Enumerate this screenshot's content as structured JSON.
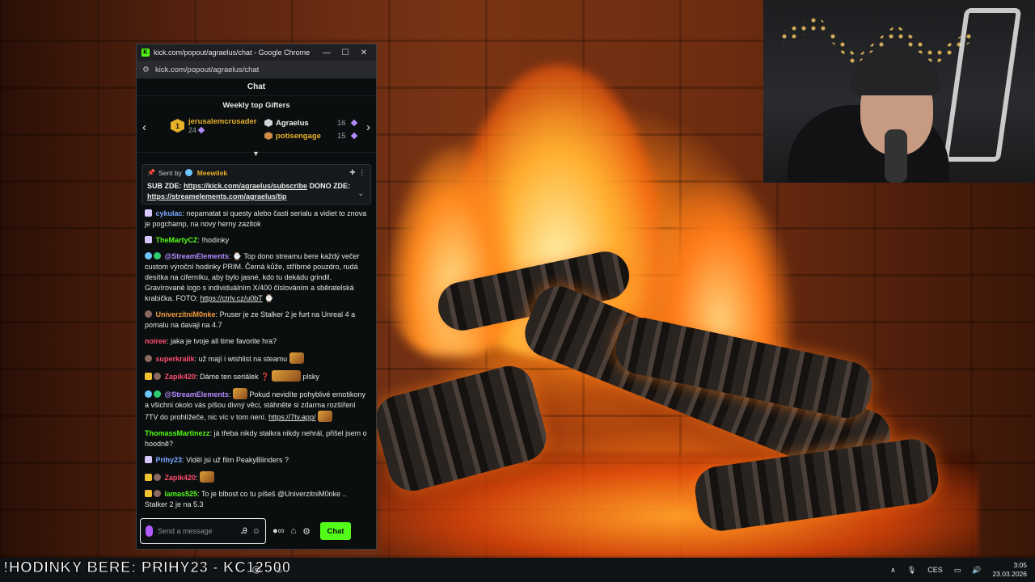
{
  "window": {
    "title": "kick.com/popout/agraelus/chat - Google Chrome",
    "url": "kick.com/popout/agraelus/chat"
  },
  "chat": {
    "header": "Chat",
    "gifters_title": "Weekly top Gifters",
    "gifters": [
      {
        "rank": "1",
        "name": "jerusalemcrusader",
        "count": "24"
      },
      {
        "name": "Agraelus",
        "count": "16"
      },
      {
        "name": "potisengage",
        "count": "15"
      }
    ],
    "pinned": {
      "label": "Sent by",
      "sender": "Meewilek",
      "text_prefix": "SUB ZDE: ",
      "link1": "https://kick.com/agraelus/subscribe",
      "text_mid": " DONO ZDE: ",
      "link2": "https://streamelements.com/agraelus/tip"
    },
    "messages": [
      {
        "user": "cykulac",
        "color": "#7aa7ff",
        "text": "nepamatat si questy alebo časti serialu a vidiet to znova je pogchamp, na novy herny zazitok"
      },
      {
        "user": "TheMartyCZ",
        "color": "#53fc18",
        "text": "!hodinky"
      },
      {
        "user": "@StreamElements",
        "color": "#b38cff",
        "text": "⌚ Top dono streamu bere každý večer custom výroční hodinky PRIM. Černá kůže, stříbrné pouzdro, rudá desítka na ciferníku, aby bylo jasné, kdo tu dekádu grindil. Gravírované logo s individuálním X/400 číslováním a sběratelská krabička. FOTO: ",
        "link": "https://ctrlv.cz/u0bT",
        "after": " ⌚"
      },
      {
        "user": "UniverzitniM0nke",
        "color": "#f39c3d",
        "text": "Pruser je ze Stalker 2 je furt na Unreal 4 a pomalu na davaji na 4.7"
      },
      {
        "user": "noiree",
        "color": "#ff4d6d",
        "text": "jaka je tvoje all time favorite hra?"
      },
      {
        "user": "superkralik",
        "color": "#ff4d6d",
        "text": "už mají i wishlist na steamu"
      },
      {
        "user": "Zapik420",
        "color": "#ff4d6d",
        "text": "Dáme ten seriálek",
        "after": "plsky"
      },
      {
        "user": "@StreamElements",
        "color": "#b38cff",
        "text": "Pokud nevidíte pohyblivé emotikony a všichni okolo vás píšou divný věci, stáhněte si zdarma rozšíření 7TV do prohlížeče, nic víc v tom není. ",
        "link": "https://7tv.app/"
      },
      {
        "user": "ThomassMartinezz",
        "color": "#53fc18",
        "text": "já třeba nikdy stalkra nikdy nehrál, přišel jsem o hoodně?"
      },
      {
        "user": "Prihy23",
        "color": "#7aa7ff",
        "text": "Viděl jsi už film PeakyBlinders ?"
      },
      {
        "user": "Zapik420",
        "color": "#ff4d6d",
        "text": ""
      },
      {
        "user": "lamas525",
        "color": "#53fc18",
        "text": "To je blbost co tu píšeš @UniverzitniM0nke .. Stalker 2 je na 5.3"
      }
    ],
    "input_placeholder": "Send a message",
    "send_label": "Chat"
  },
  "taskbar": {
    "ticker": "!HODINKY BERE: PRIHY23 - KC12500",
    "lang": "CES",
    "time": "3:05",
    "date": "23.03.2026"
  },
  "colors": {
    "kick_green": "#53fc18",
    "gold": "#e8b22a"
  }
}
